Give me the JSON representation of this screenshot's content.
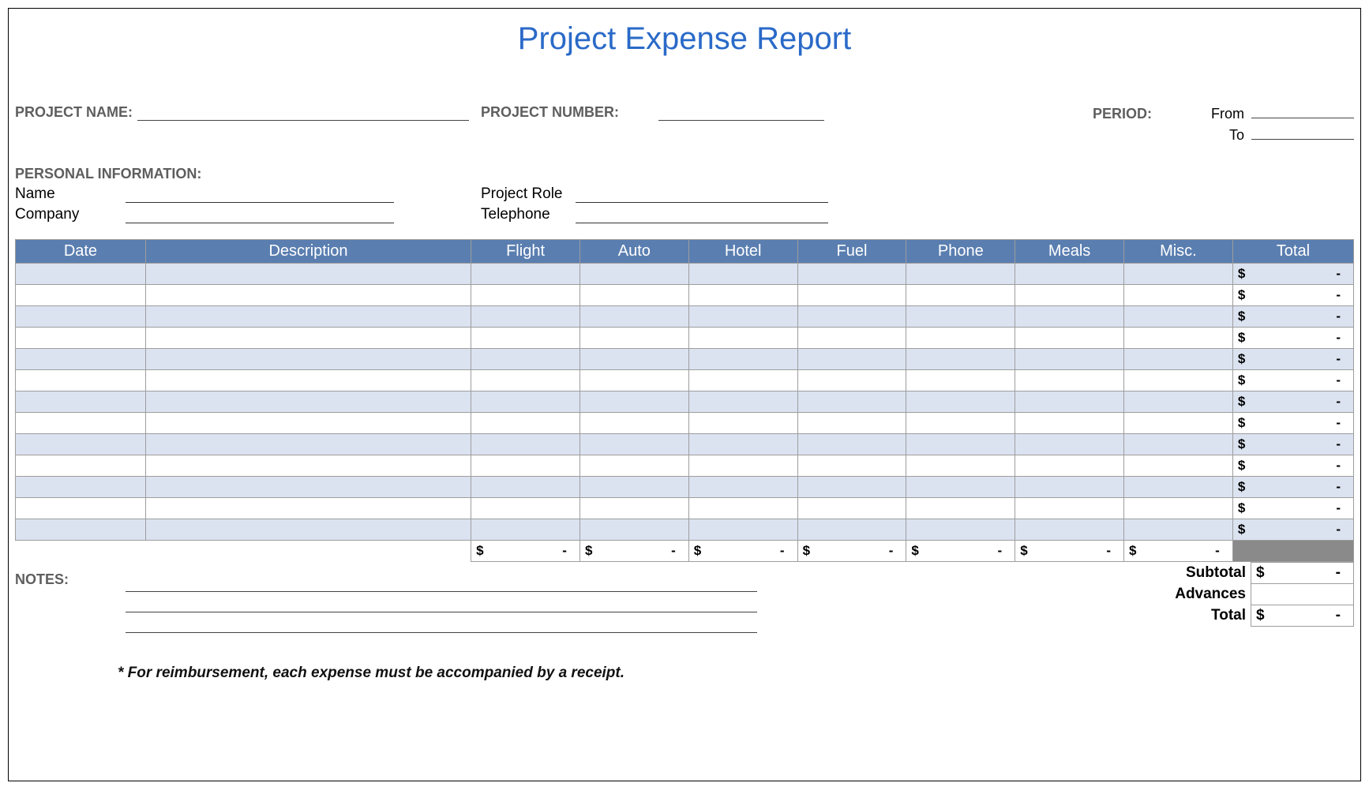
{
  "title": "Project Expense Report",
  "labels": {
    "project_name": "PROJECT NAME:",
    "project_number": "PROJECT NUMBER:",
    "period": "PERIOD:",
    "from": "From",
    "to": "To",
    "personal_info": "PERSONAL INFORMATION:",
    "name": "Name",
    "company": "Company",
    "project_role": "Project Role",
    "telephone": "Telephone",
    "notes": "NOTES:"
  },
  "columns": {
    "date": "Date",
    "description": "Description",
    "flight": "Flight",
    "auto": "Auto",
    "hotel": "Hotel",
    "fuel": "Fuel",
    "phone": "Phone",
    "meals": "Meals",
    "misc": "Misc.",
    "total": "Total"
  },
  "row_total": {
    "dollar": "$",
    "dash": "-"
  },
  "coltotal": {
    "dollar": "$",
    "dash": "-"
  },
  "summary": {
    "subtotal_label": "Subtotal",
    "advances_label": "Advances",
    "total_label": "Total",
    "dollar": "$",
    "dash": "-"
  },
  "footnote": "* For reimbursement, each expense must be accompanied by a receipt."
}
